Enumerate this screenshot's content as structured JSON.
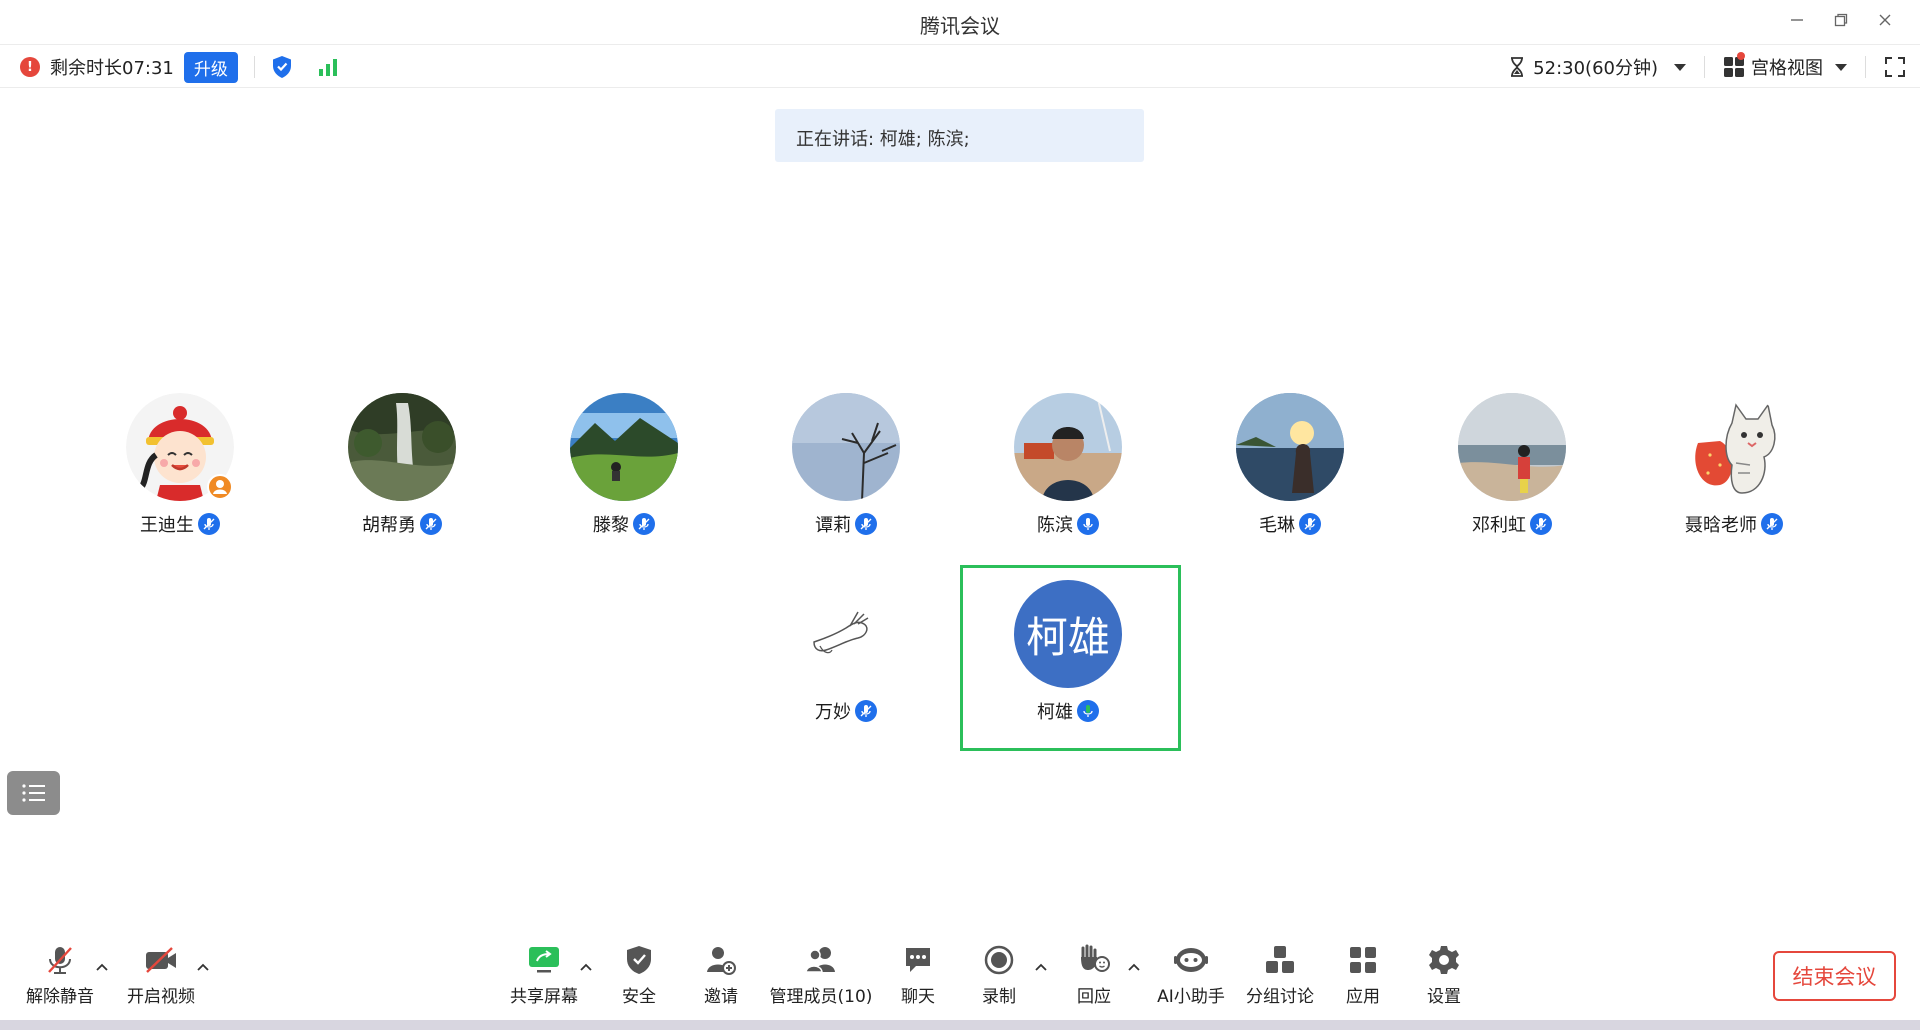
{
  "window": {
    "title": "腾讯会议"
  },
  "status": {
    "remaining": "剩余时长07:31",
    "upgrade_label": "升级",
    "timer": "52:30(60分钟)",
    "view_label": "宫格视图"
  },
  "speaking": {
    "text": "正在讲话: 柯雄; 陈滨;"
  },
  "participants": [
    {
      "name": "王迪生",
      "avatar": "cartoon-girl"
    },
    {
      "name": "胡帮勇",
      "avatar": "waterfall"
    },
    {
      "name": "滕黎",
      "avatar": "mountain-meadow"
    },
    {
      "name": "谭莉",
      "avatar": "bare-tree-sky"
    },
    {
      "name": "陈滨",
      "avatar": "man-portrait"
    },
    {
      "name": "毛琳",
      "avatar": "sunset-lake"
    },
    {
      "name": "邓利虹",
      "avatar": "beach"
    },
    {
      "name": "聂晗老师",
      "avatar": "cat-strawberry"
    },
    {
      "name": "万妙",
      "avatar": "hand-sketch"
    },
    {
      "name": "柯雄",
      "avatar_text": "柯雄"
    }
  ],
  "toolbar": {
    "unmute": "解除静音",
    "start_video": "开启视频",
    "share_screen": "共享屏幕",
    "security": "安全",
    "invite": "邀请",
    "manage_members": "管理成员(10)",
    "chat": "聊天",
    "record": "录制",
    "react": "回应",
    "ai_assistant": "AI小助手",
    "breakout": "分组讨论",
    "apps": "应用",
    "settings": "设置",
    "end_meeting": "结束会议"
  },
  "colors": {
    "accent": "#1f6feb",
    "danger": "#e5473c",
    "active_speaker": "#2bbf5a",
    "banner": "#e8f0fb"
  }
}
